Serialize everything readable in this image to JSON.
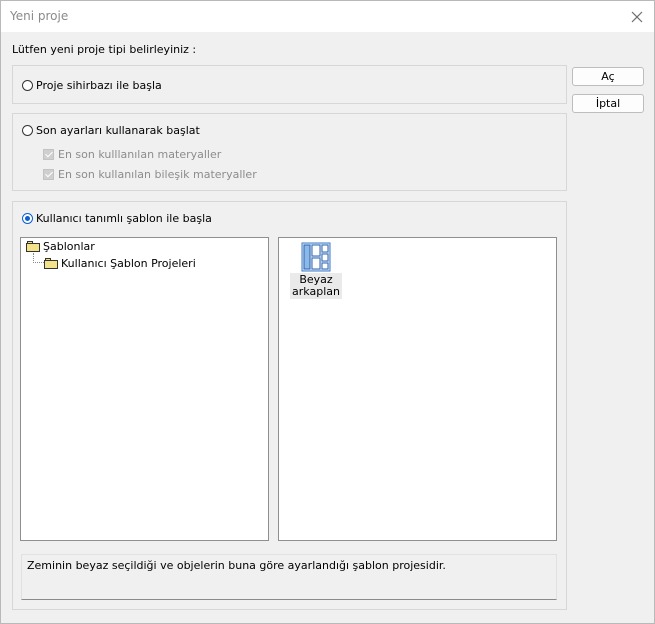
{
  "window": {
    "title": "Yeni proje"
  },
  "prompt": "Lütfen yeni proje tipi belirleyiniz :",
  "options": {
    "wizard": {
      "label": "Proje sihirbazı ile başla",
      "checked": false
    },
    "recent": {
      "label": "Son ayarları kullanarak başlat",
      "checked": false,
      "checkboxes": [
        {
          "label": "En son kulllanılan materyaller",
          "checked": true,
          "disabled": true
        },
        {
          "label": "En son kullanılan bileşik materyaller",
          "checked": true,
          "disabled": true
        }
      ]
    },
    "template": {
      "label": "Kullanıcı tanımlı şablon ile başla",
      "checked": true
    }
  },
  "buttons": {
    "open": "Aç",
    "cancel": "İptal"
  },
  "tree": {
    "root": "Şablonlar",
    "child": "Kullanıcı Şablon Projeleri"
  },
  "templates": [
    {
      "label_line1": "Beyaz",
      "label_line2": "arkaplan",
      "icon": "layout-template-icon"
    }
  ],
  "description": "Zeminin beyaz seçildiği ve objelerin buna göre ayarlandığı şablon projesidir."
}
